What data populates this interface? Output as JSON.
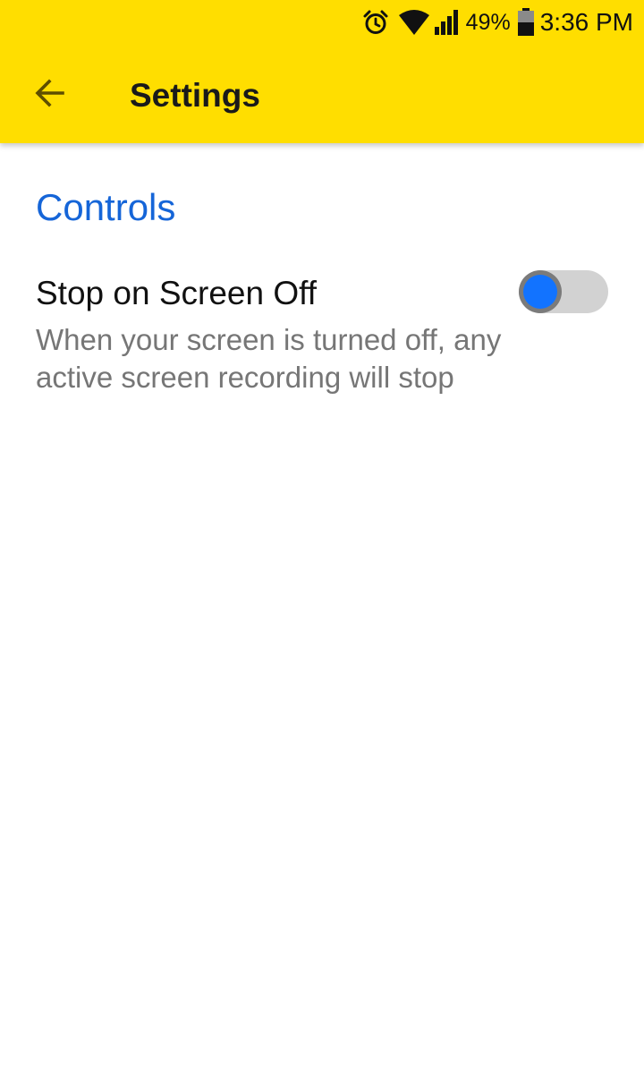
{
  "status_bar": {
    "icons": [
      "alarm-icon",
      "wifi-icon",
      "signal-icon",
      "battery-icon"
    ],
    "battery_percent": "49%",
    "time": "3:36 PM"
  },
  "app_bar": {
    "back_icon": "arrow-left-icon",
    "title": "Settings",
    "background_color": "#FFDE00"
  },
  "section": {
    "title": "Controls",
    "color": "#1565D8"
  },
  "preference": {
    "title": "Stop on Screen Off",
    "summary": "When your screen is turned off, any active screen recording will stop",
    "toggle_on": false,
    "thumb_color": "#1273FF"
  }
}
